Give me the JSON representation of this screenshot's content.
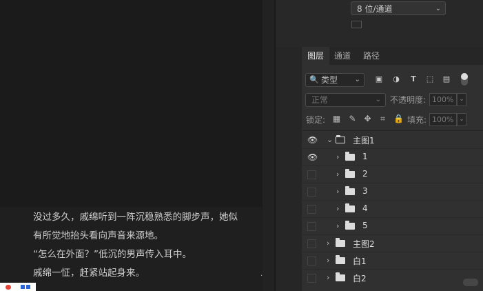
{
  "properties": {
    "mode_select": "8 位/通道"
  },
  "tabs": {
    "layers": "图层",
    "channels": "通道",
    "paths": "路径"
  },
  "filter": {
    "kind_label": "类型"
  },
  "blend": {
    "mode": "正常",
    "opacity_label": "不透明度:",
    "opacity_value": "100%"
  },
  "lock": {
    "label": "锁定:",
    "fill_label": "填充:",
    "fill_value": "100%"
  },
  "layers": [
    {
      "name": "主图1",
      "visible": true,
      "expanded": true,
      "level": 0
    },
    {
      "name": "1",
      "visible": true,
      "expanded": false,
      "level": 1
    },
    {
      "name": "2",
      "visible": false,
      "expanded": false,
      "level": 1
    },
    {
      "name": "3",
      "visible": false,
      "expanded": false,
      "level": 1
    },
    {
      "name": "4",
      "visible": false,
      "expanded": false,
      "level": 1
    },
    {
      "name": "5",
      "visible": false,
      "expanded": false,
      "level": 1
    },
    {
      "name": "主图2",
      "visible": false,
      "expanded": false,
      "level": 0
    },
    {
      "name": "白1",
      "visible": false,
      "expanded": false,
      "level": 0
    },
    {
      "name": "白2",
      "visible": false,
      "expanded": false,
      "level": 0
    }
  ],
  "story": {
    "lines": [
      "没过多久，戚绵听到一阵沉稳熟悉的脚步声，她似",
      "有所觉地抬头看向声音来源地。",
      "“怎么在外面？”低沉的男声传入耳中。",
      "戚绵一怔，赶紧站起身来。"
    ]
  },
  "colors": {
    "canvas": "#1b1b1b",
    "panel": "#303030"
  }
}
